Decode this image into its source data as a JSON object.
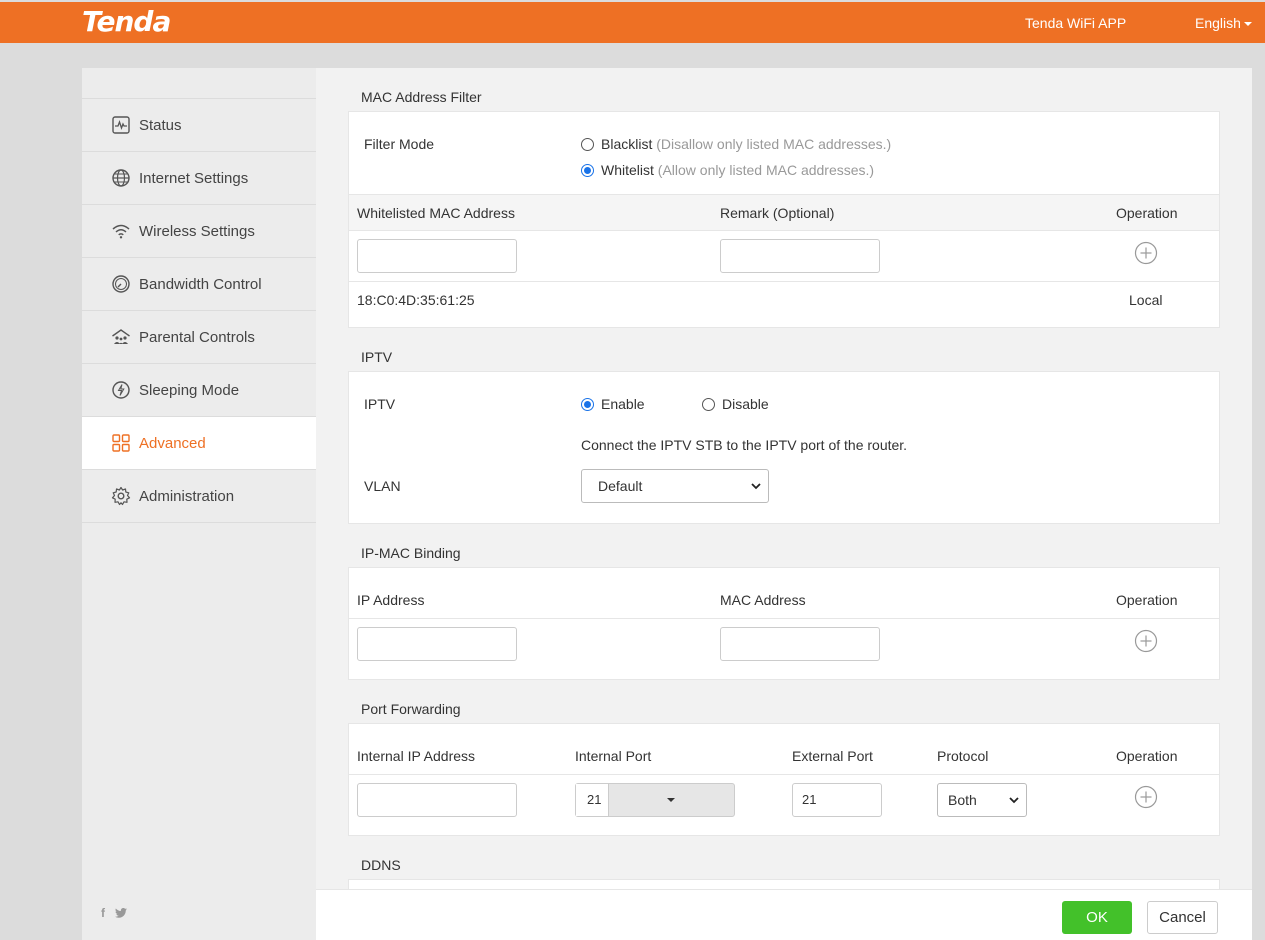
{
  "header": {
    "logo": "Tenda",
    "app_link": "Tenda WiFi APP",
    "language": "English"
  },
  "sidebar": {
    "items": [
      {
        "label": "Status",
        "icon": "status-icon"
      },
      {
        "label": "Internet Settings",
        "icon": "globe-icon"
      },
      {
        "label": "Wireless Settings",
        "icon": "wifi-icon"
      },
      {
        "label": "Bandwidth Control",
        "icon": "speedometer-icon"
      },
      {
        "label": "Parental Controls",
        "icon": "family-icon"
      },
      {
        "label": "Sleeping Mode",
        "icon": "sleep-icon"
      },
      {
        "label": "Advanced",
        "icon": "grid-icon",
        "active": true
      },
      {
        "label": "Administration",
        "icon": "gear-icon"
      }
    ],
    "social": {
      "facebook": "f",
      "twitter": "twitter-icon"
    }
  },
  "mac_filter": {
    "title": "MAC Address Filter",
    "filter_mode_label": "Filter Mode",
    "blacklist": {
      "label": "Blacklist",
      "hint": "(Disallow only listed MAC addresses.)",
      "selected": false
    },
    "whitelist": {
      "label": "Whitelist",
      "hint": "(Allow only listed MAC addresses.)",
      "selected": true
    },
    "columns": [
      "Whitelisted MAC Address",
      "Remark (Optional)",
      "Operation"
    ],
    "mac_input_value": "",
    "remark_input_value": "",
    "rows": [
      {
        "mac": "18:C0:4D:35:61:25",
        "remark": "",
        "operation": "Local"
      }
    ]
  },
  "iptv": {
    "title": "IPTV",
    "label": "IPTV",
    "enable_label": "Enable",
    "disable_label": "Disable",
    "enabled": true,
    "hint": "Connect the IPTV STB to the IPTV port of the router.",
    "vlan_label": "VLAN",
    "vlan_value": "Default"
  },
  "ip_mac_binding": {
    "title": "IP-MAC Binding",
    "columns": [
      "IP Address",
      "MAC Address",
      "Operation"
    ],
    "ip_input_value": "",
    "mac_input_value": ""
  },
  "port_forwarding": {
    "title": "Port Forwarding",
    "columns": [
      "Internal IP Address",
      "Internal Port",
      "External Port",
      "Protocol",
      "Operation"
    ],
    "internal_ip_value": "",
    "internal_port_value": "21",
    "external_port_value": "21",
    "protocol_value": "Both"
  },
  "ddns": {
    "title": "DDNS"
  },
  "footer": {
    "ok_label": "OK",
    "cancel_label": "Cancel"
  },
  "colors": {
    "brand": "#ee7024",
    "ok": "#43c12a",
    "radio": "#1a73e8"
  }
}
